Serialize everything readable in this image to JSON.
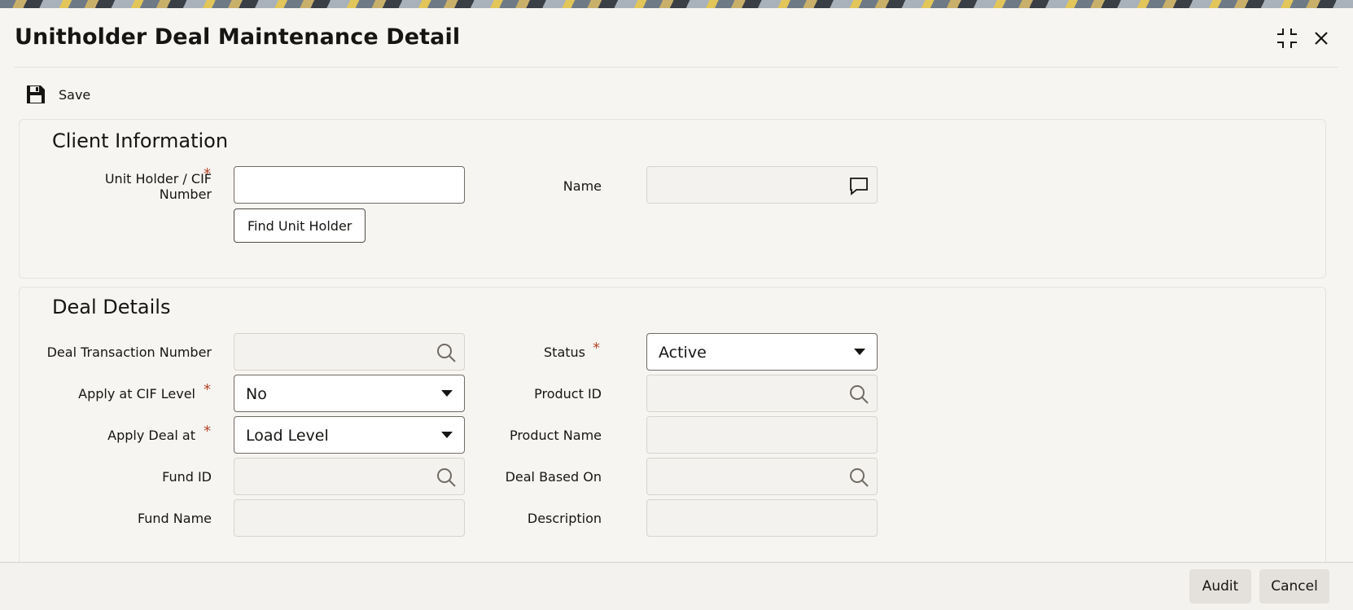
{
  "window": {
    "title": "Unitholder Deal Maintenance Detail"
  },
  "toolbar": {
    "save_label": "Save"
  },
  "client_info": {
    "heading": "Client Information",
    "unit_holder_label": "Unit Holder / CIF Number",
    "unit_holder_value": "",
    "name_label": "Name",
    "name_value": "",
    "find_button_label": "Find Unit Holder"
  },
  "deal_details": {
    "heading": "Deal Details",
    "deal_txn_number_label": "Deal Transaction Number",
    "deal_txn_number_value": "",
    "status_label": "Status",
    "status_value": "Active",
    "apply_cif_label": "Apply at CIF Level",
    "apply_cif_value": "No",
    "product_id_label": "Product ID",
    "product_id_value": "",
    "apply_deal_at_label": "Apply Deal at",
    "apply_deal_at_value": "Load Level",
    "product_name_label": "Product Name",
    "product_name_value": "",
    "fund_id_label": "Fund ID",
    "fund_id_value": "",
    "deal_based_on_label": "Deal Based On",
    "deal_based_on_value": "",
    "fund_name_label": "Fund Name",
    "fund_name_value": "",
    "description_label": "Description",
    "description_value": ""
  },
  "footer": {
    "audit_label": "Audit",
    "cancel_label": "Cancel"
  },
  "colors": {
    "required": "#b7472a",
    "text": "#161513",
    "panel": "#f7f5f2"
  }
}
